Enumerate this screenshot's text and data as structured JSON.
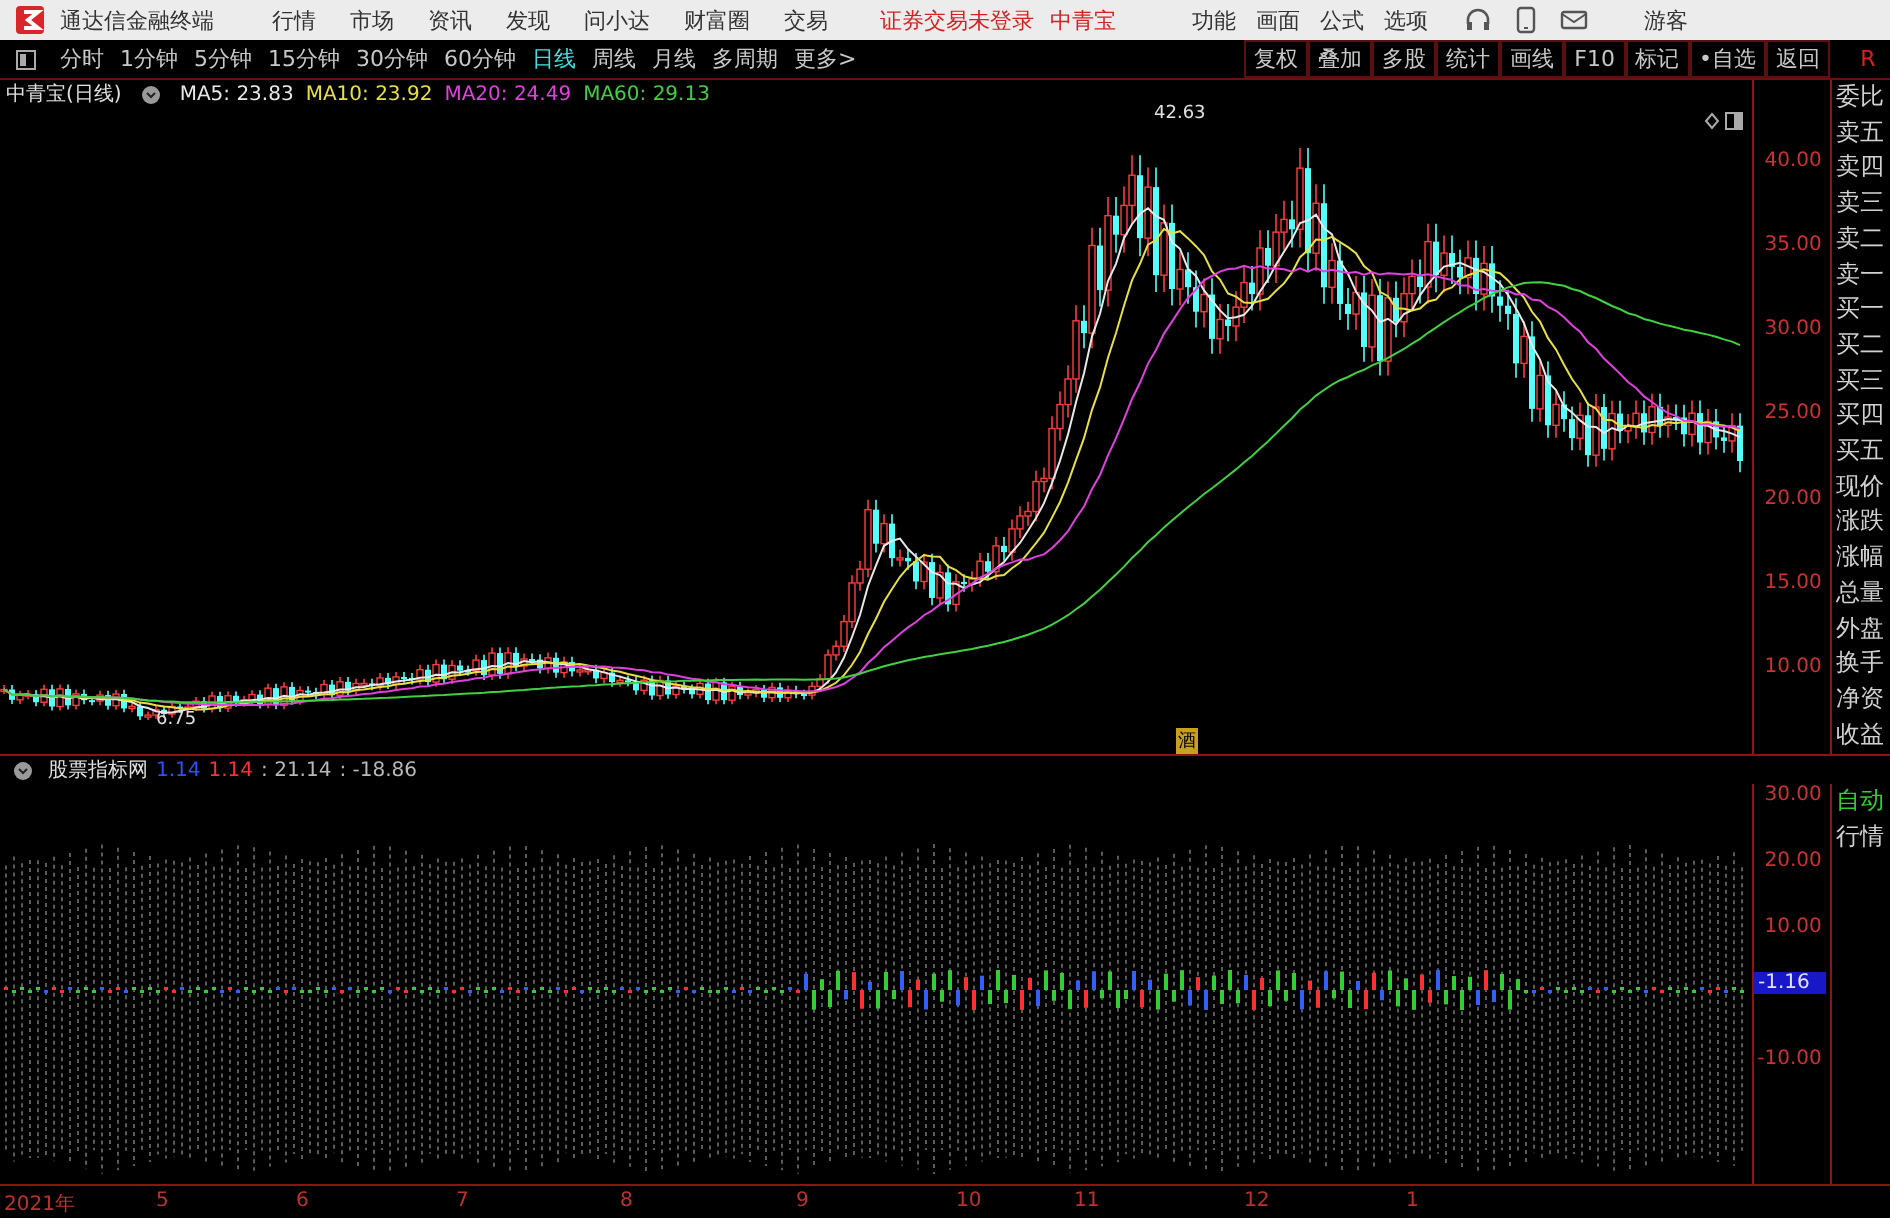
{
  "app_bar": {
    "title": "通达信金融终端",
    "menus": [
      "行情",
      "市场",
      "资讯",
      "发现",
      "问小达",
      "财富圈",
      "交易"
    ],
    "notice": "证券交易未登录",
    "stock": "中青宝",
    "tools": [
      "功能",
      "画面",
      "公式",
      "选项"
    ],
    "user": "游客"
  },
  "period_bar": {
    "periods": [
      {
        "label": "分时",
        "selected": false
      },
      {
        "label": "1分钟",
        "selected": false
      },
      {
        "label": "5分钟",
        "selected": false
      },
      {
        "label": "15分钟",
        "selected": false
      },
      {
        "label": "30分钟",
        "selected": false
      },
      {
        "label": "60分钟",
        "selected": false
      },
      {
        "label": "日线",
        "selected": true
      },
      {
        "label": "周线",
        "selected": false
      },
      {
        "label": "月线",
        "selected": false
      },
      {
        "label": "多周期",
        "selected": false
      }
    ],
    "more": "更多>",
    "actions": [
      "复权",
      "叠加",
      "多股",
      "统计",
      "画线",
      "F10",
      "标记",
      "•自选",
      "返回"
    ],
    "corner": "R"
  },
  "price_chart": {
    "title": "中青宝(日线)",
    "ma": [
      {
        "label": "MA5: 23.83",
        "color": "#e8e8e8"
      },
      {
        "label": "MA10: 23.92",
        "color": "#e8e040"
      },
      {
        "label": "MA20: 24.49",
        "color": "#e040e0"
      },
      {
        "label": "MA60: 29.13",
        "color": "#40d040"
      }
    ],
    "high_label": "42.63",
    "low_label": "6.75",
    "event_mark": "酒",
    "y_labels": [
      "40.00",
      "35.00",
      "30.00",
      "25.00",
      "20.00",
      "15.00",
      "10.00"
    ]
  },
  "quote_panel": {
    "items": [
      "委比",
      "卖五",
      "卖四",
      "卖三",
      "卖二",
      "卖一",
      "买一",
      "买二",
      "买三",
      "买四",
      "买五",
      "现价",
      "涨跌",
      "涨幅",
      "总量",
      "外盘",
      "换手",
      "净资",
      "收益"
    ]
  },
  "indicator": {
    "name": "股票指标网",
    "values": [
      {
        "text": "1.14",
        "color": "#3050ff"
      },
      {
        "text": "1.14",
        "color": "#ff3030"
      },
      {
        "text": ": 21.14",
        "color": "#b8b8b8"
      },
      {
        "text": ": -18.86",
        "color": "#b8b8b8"
      }
    ],
    "y_labels": [
      "30.00",
      "20.00",
      "10.00",
      "-10.00"
    ],
    "current": "-1.16",
    "side": [
      "自动",
      "行情"
    ]
  },
  "date_axis": [
    "2021年",
    "5",
    "6",
    "7",
    "8",
    "9",
    "10",
    "11",
    "12",
    "1"
  ]
}
